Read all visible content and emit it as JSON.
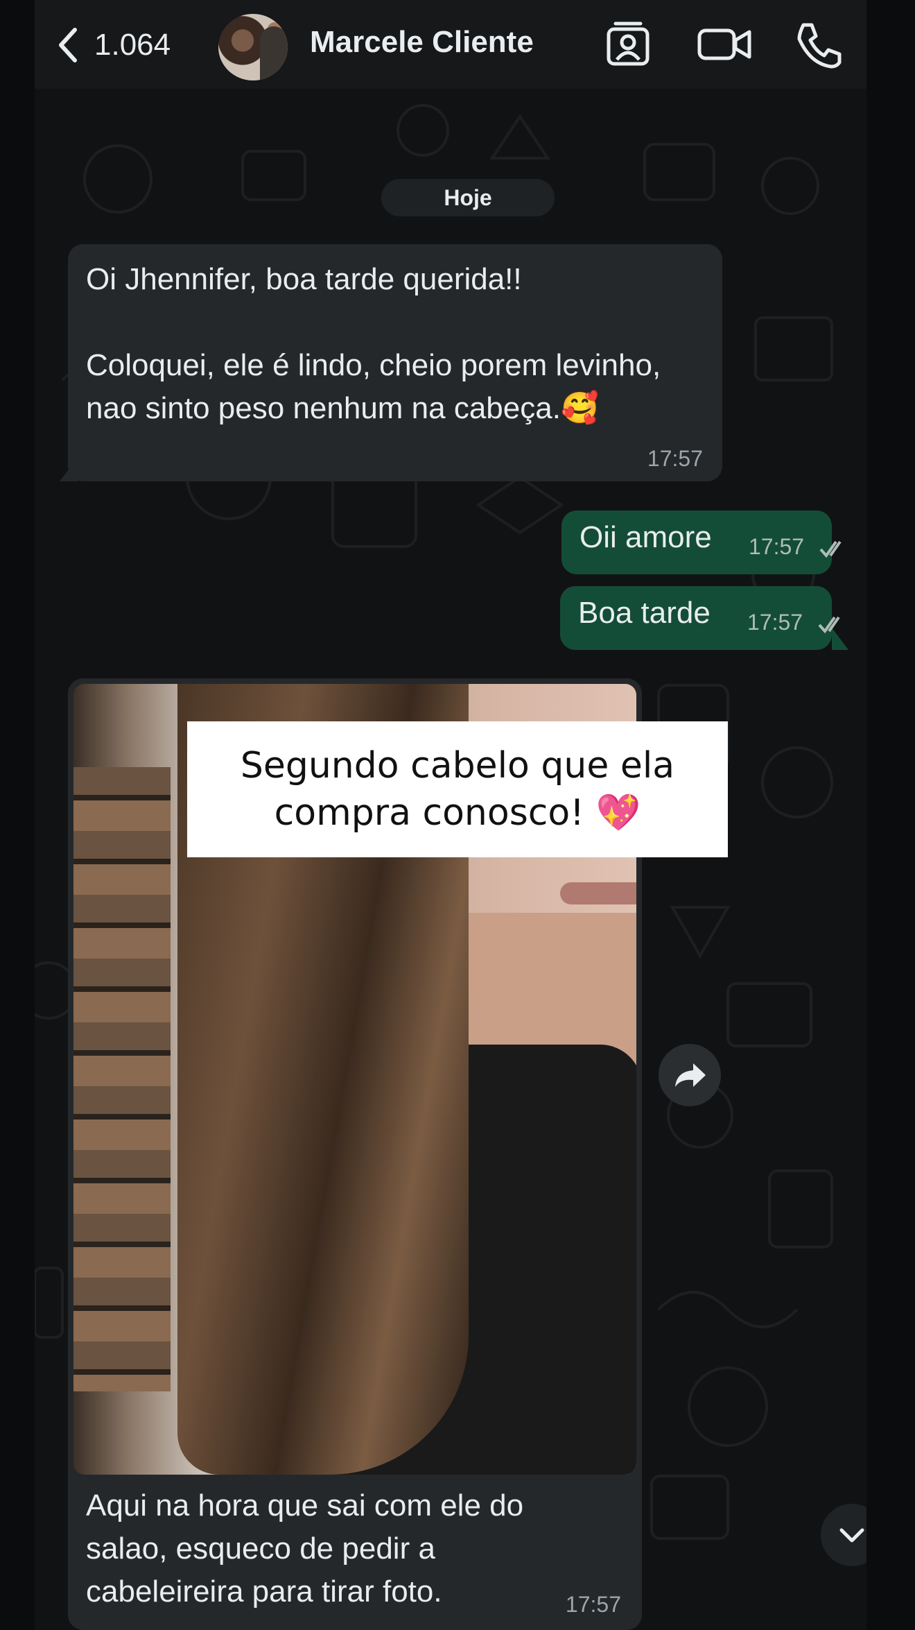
{
  "header": {
    "back_count": "1.064",
    "contact_name": "Marcele Cliente",
    "icons": [
      "back-chevron-icon",
      "contact-card-icon",
      "video-call-icon",
      "phone-call-icon"
    ]
  },
  "date_chip": "Hoje",
  "messages": [
    {
      "direction": "incoming",
      "text": "Oi Jhennifer, boa tarde querida!!\n\nColoquei, ele é lindo, cheio porem levinho, nao sinto peso nenhum na cabeça.🥰",
      "time": "17:57"
    },
    {
      "direction": "outgoing",
      "text": "Oii amore",
      "time": "17:57",
      "status": "read"
    },
    {
      "direction": "outgoing",
      "text": "Boa tarde",
      "time": "17:57",
      "status": "read"
    },
    {
      "direction": "incoming",
      "type": "image",
      "text": "Aqui na hora que sai com ele do salao, esqueco de pedir a cabeleireira para tirar foto.",
      "time": "17:57"
    }
  ],
  "overlay_caption": {
    "line1": "Segundo cabelo que ela",
    "line2": "compra conosco!",
    "emoji": "💖"
  },
  "colors": {
    "incoming_bubble": "#25282b",
    "outgoing_bubble": "#144d37",
    "background": "#111214",
    "read_ticks": "#aebdb5"
  }
}
